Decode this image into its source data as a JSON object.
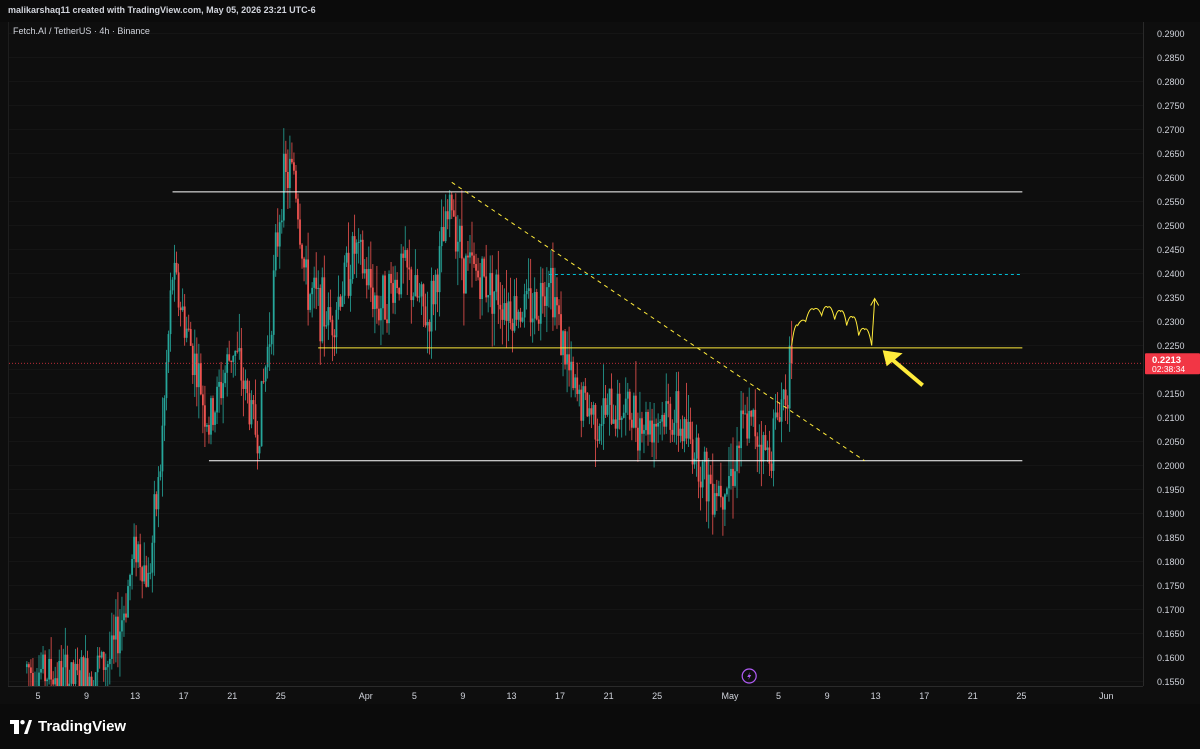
{
  "header": {
    "attribution": "malikarshaq11 created with TradingView.com, May 05, 2026 23:21 UTC-6"
  },
  "symbol": {
    "label": "Fetch.AI / TetherUS · 4h · Binance"
  },
  "price_badge": {
    "price": "0.2213",
    "countdown": "02:38:34",
    "color": "#f23645"
  },
  "brand": {
    "name": "TradingView"
  },
  "colors": {
    "up": "#26a69a",
    "down": "#ef5350",
    "level_white": "#ffffff",
    "level_yellow": "#ffeb3b",
    "target_teal": "#00bcd4",
    "current_price_line": "#f23645"
  },
  "chart_data": {
    "type": "candlestick",
    "timeframe": "4h",
    "y_ticks": [
      "0.2900",
      "0.2850",
      "0.2800",
      "0.2750",
      "0.2700",
      "0.2650",
      "0.2600",
      "0.2550",
      "0.2500",
      "0.2450",
      "0.2400",
      "0.2350",
      "0.2300",
      "0.2250",
      "0.2200",
      "0.2150",
      "0.2100",
      "0.2050",
      "0.2000",
      "0.1950",
      "0.1900",
      "0.1850",
      "0.1800",
      "0.1750",
      "0.1700",
      "0.1650",
      "0.1600",
      "0.1550"
    ],
    "x_ticks": [
      "5",
      "9",
      "13",
      "17",
      "21",
      "25",
      "Apr",
      "5",
      "9",
      "13",
      "17",
      "21",
      "25",
      "May",
      "5",
      "9",
      "13",
      "17",
      "21",
      "25",
      "Jun"
    ],
    "ylim": [
      0.1545,
      0.2915
    ],
    "current_price": 0.2213,
    "price_path": [
      {
        "date": "Mar 04",
        "price": 0.158
      },
      {
        "date": "Mar 08",
        "price": 0.155
      },
      {
        "date": "Mar 11",
        "price": 0.16
      },
      {
        "date": "Mar 12",
        "price": 0.17
      },
      {
        "date": "Mar 13",
        "price": 0.184
      },
      {
        "date": "Mar 14",
        "price": 0.176
      },
      {
        "date": "Mar 15",
        "price": 0.2
      },
      {
        "date": "Mar 16",
        "price": 0.24
      },
      {
        "date": "Mar 17",
        "price": 0.23
      },
      {
        "date": "Mar 18",
        "price": 0.22
      },
      {
        "date": "Mar 19",
        "price": 0.208
      },
      {
        "date": "Mar 21",
        "price": 0.225
      },
      {
        "date": "Mar 23",
        "price": 0.206
      },
      {
        "date": "Mar 24",
        "price": 0.228
      },
      {
        "date": "Mar 25",
        "price": 0.258
      },
      {
        "date": "Mar 26",
        "price": 0.262
      },
      {
        "date": "Mar 27",
        "price": 0.237
      },
      {
        "date": "Mar 29",
        "price": 0.23
      },
      {
        "date": "Mar 31",
        "price": 0.245
      },
      {
        "date": "Apr 02",
        "price": 0.233
      },
      {
        "date": "Apr 04",
        "price": 0.241
      },
      {
        "date": "Apr 06",
        "price": 0.23
      },
      {
        "date": "Apr 08",
        "price": 0.255
      },
      {
        "date": "Apr 09",
        "price": 0.242
      },
      {
        "date": "Apr 11",
        "price": 0.238
      },
      {
        "date": "Apr 13",
        "price": 0.233
      },
      {
        "date": "Apr 15",
        "price": 0.233
      },
      {
        "date": "Apr 16",
        "price": 0.242
      },
      {
        "date": "Apr 17",
        "price": 0.227
      },
      {
        "date": "Apr 18",
        "price": 0.215
      },
      {
        "date": "Apr 20",
        "price": 0.21
      },
      {
        "date": "Apr 22",
        "price": 0.212
      },
      {
        "date": "Apr 24",
        "price": 0.209
      },
      {
        "date": "Apr 26",
        "price": 0.211
      },
      {
        "date": "Apr 28",
        "price": 0.204
      },
      {
        "date": "Apr 29",
        "price": 0.197
      },
      {
        "date": "Apr 30",
        "price": 0.196
      },
      {
        "date": "May 01",
        "price": 0.1985
      },
      {
        "date": "May 02",
        "price": 0.208
      },
      {
        "date": "May 03",
        "price": 0.208
      },
      {
        "date": "May 04",
        "price": 0.202
      },
      {
        "date": "May 05",
        "price": 0.212
      },
      {
        "date": "May 06",
        "price": 0.2213
      }
    ],
    "levels": [
      {
        "price": 0.257,
        "from": "Mar 16",
        "to": "May 25",
        "color": "#ffffff"
      },
      {
        "price": 0.201,
        "from": "Mar 19",
        "to": "May 25",
        "color": "#ffffff"
      },
      {
        "price": 0.2245,
        "from": "Mar 28",
        "to": "May 25",
        "color": "#ffeb3b"
      },
      {
        "price": 0.2398,
        "from": "Apr 16",
        "to": "May 25",
        "color": "#00bcd4",
        "style": "dashed"
      }
    ],
    "trendline": {
      "from_date": "Apr 08",
      "from_price": 0.259,
      "to_date": "May 12",
      "to_price": 0.201,
      "style": "dashed",
      "color": "#ffeb3b"
    }
  }
}
